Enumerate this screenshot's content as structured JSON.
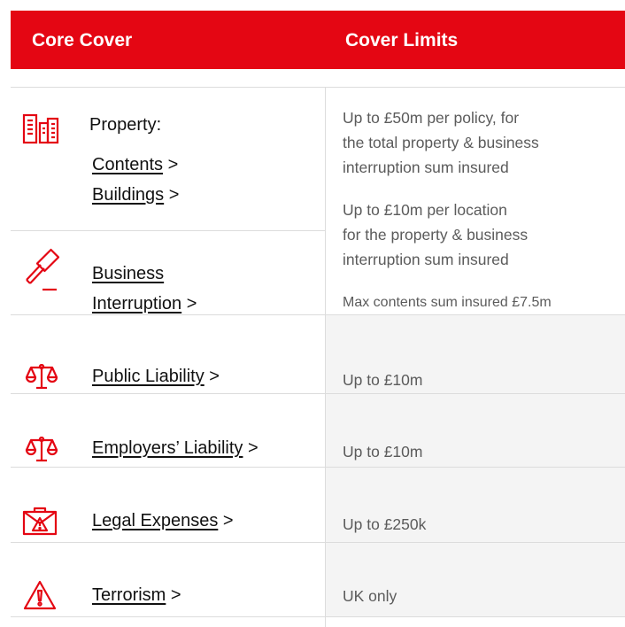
{
  "header": {
    "col1": "Core Cover",
    "col2": "Cover Limits"
  },
  "rows": {
    "property": {
      "title": "Property:",
      "link1": "Contents",
      "link2": "Buildings",
      "arrow": ">"
    },
    "business": {
      "link_line1": "Business",
      "link_line2": "Interruption",
      "arrow": ">"
    },
    "property_limits": {
      "l1": "Up to £50m per policy, for",
      "l2": "the total property & business",
      "l3": "interruption sum insured",
      "l4": "Up to £10m per location",
      "l5": "for the property & business",
      "l6": "interruption sum insured",
      "l7": "Max contents sum insured £7.5m"
    },
    "public": {
      "link": "Public Liability",
      "arrow": ">",
      "limit": "Up to £10m"
    },
    "employers": {
      "link": "Employers’ Liability",
      "arrow": ">",
      "limit": "Up to £10m"
    },
    "legal": {
      "link": "Legal Expenses",
      "arrow": ">",
      "limit": "Up to £250k"
    },
    "terrorism": {
      "link": "Terrorism",
      "arrow": ">",
      "limit": "UK only"
    }
  },
  "colors": {
    "brand_red": "#e40613",
    "row_shade": "#f4f4f4"
  },
  "icons": [
    "buildings-icon",
    "gavel-icon",
    "scales-icon",
    "scales-icon",
    "briefcase-warning-icon",
    "warning-icon"
  ]
}
